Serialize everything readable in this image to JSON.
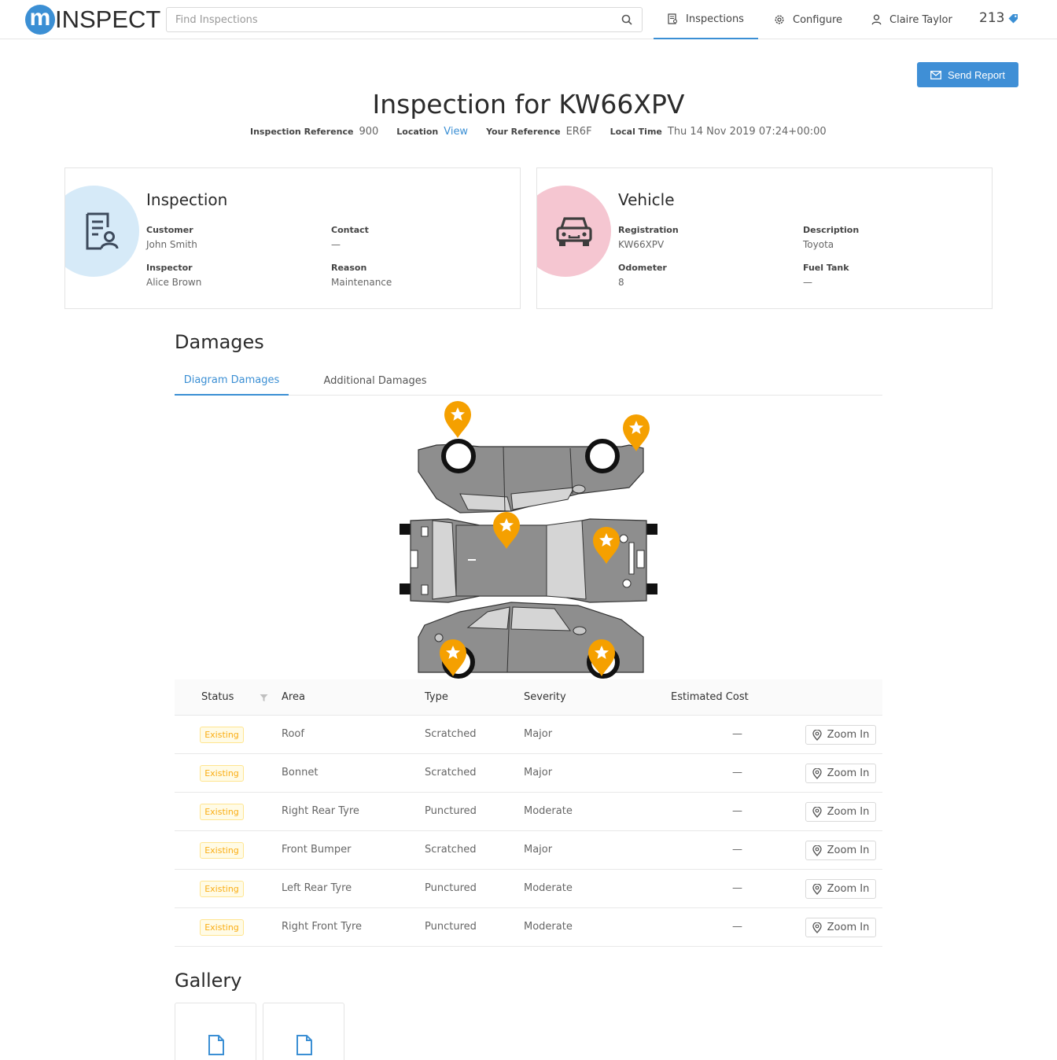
{
  "header": {
    "logo_letter": "m",
    "logo_text": "INSPECT",
    "search_placeholder": "Find Inspections",
    "nav": {
      "inspections": "Inspections",
      "configure": "Configure",
      "user": "Claire Taylor"
    },
    "credits": "213"
  },
  "page": {
    "send_report": "Send Report",
    "title": "Inspection for KW66XPV",
    "meta": {
      "ref_label": "Inspection Reference",
      "ref_value": "900",
      "location_label": "Location",
      "location_value": "View",
      "your_ref_label": "Your Reference",
      "your_ref_value": "ER6F",
      "time_label": "Local Time",
      "time_value": "Thu 14 Nov 2019 07:24+00:00"
    }
  },
  "inspection_card": {
    "title": "Inspection",
    "customer_label": "Customer",
    "customer": "John Smith",
    "contact_label": "Contact",
    "contact": "—",
    "inspector_label": "Inspector",
    "inspector": "Alice Brown",
    "reason_label": "Reason",
    "reason": "Maintenance"
  },
  "vehicle_card": {
    "title": "Vehicle",
    "registration_label": "Registration",
    "registration": "KW66XPV",
    "description_label": "Description",
    "description": "Toyota",
    "odometer_label": "Odometer",
    "odometer": "8",
    "fuel_label": "Fuel Tank",
    "fuel": "—"
  },
  "damages": {
    "title": "Damages",
    "tabs": [
      "Diagram Damages",
      "Additional Damages"
    ],
    "columns": [
      "Status",
      "Area",
      "Type",
      "Severity",
      "Estimated Cost"
    ],
    "zoom_label": "Zoom In",
    "rows": [
      {
        "status": "Existing",
        "area": "Roof",
        "type": "Scratched",
        "severity": "Major",
        "cost": "—"
      },
      {
        "status": "Existing",
        "area": "Bonnet",
        "type": "Scratched",
        "severity": "Major",
        "cost": "—"
      },
      {
        "status": "Existing",
        "area": "Right Rear Tyre",
        "type": "Punctured",
        "severity": "Moderate",
        "cost": "—"
      },
      {
        "status": "Existing",
        "area": "Front Bumper",
        "type": "Scratched",
        "severity": "Major",
        "cost": "—"
      },
      {
        "status": "Existing",
        "area": "Left Rear Tyre",
        "type": "Punctured",
        "severity": "Moderate",
        "cost": "—"
      },
      {
        "status": "Existing",
        "area": "Right Front Tyre",
        "type": "Punctured",
        "severity": "Moderate",
        "cost": "—"
      }
    ]
  },
  "gallery": {
    "title": "Gallery"
  },
  "colors": {
    "primary": "#3b8fd4",
    "inspection_circle": "#d6eaf8",
    "vehicle_circle": "#f5c6d1",
    "pin": "#f5a000",
    "badge_text": "#faad14"
  }
}
